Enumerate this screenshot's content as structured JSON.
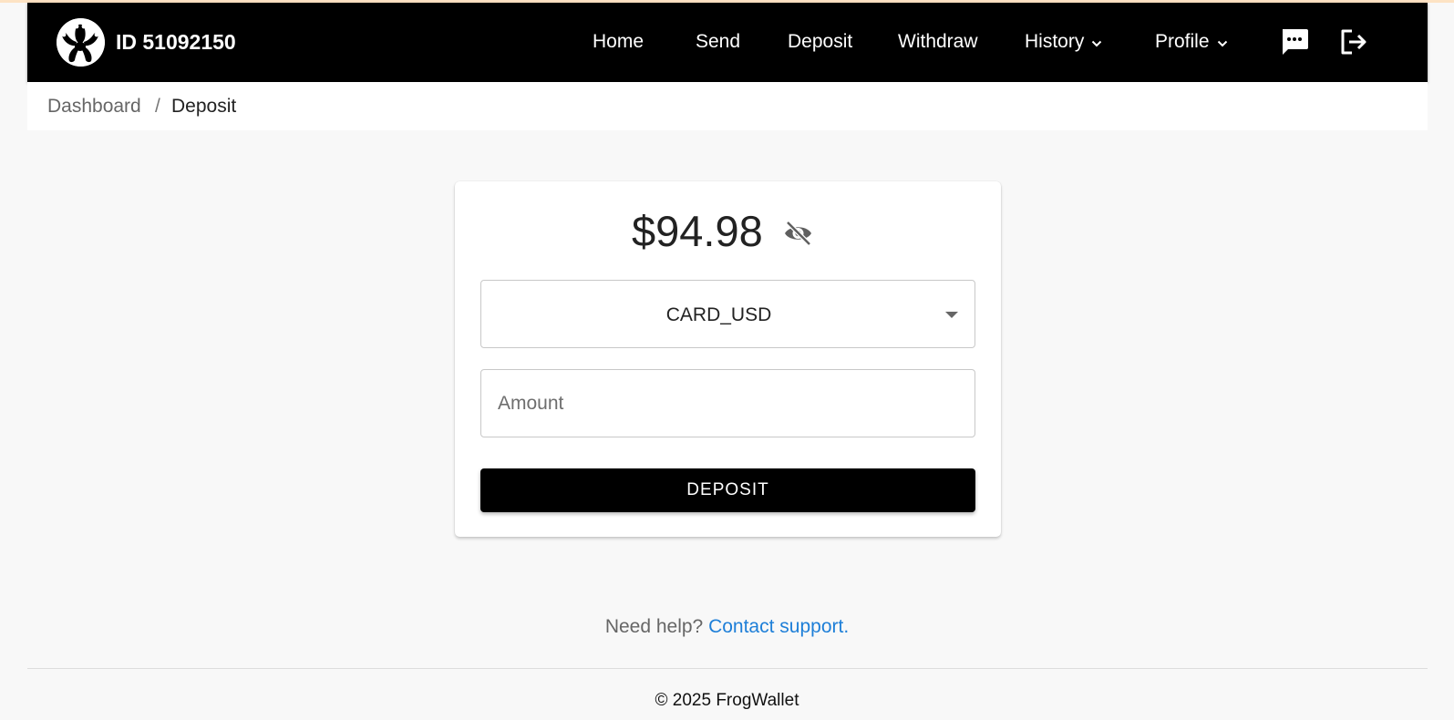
{
  "header": {
    "account_id": "ID 51092150",
    "nav": {
      "home": "Home",
      "send": "Send",
      "deposit": "Deposit",
      "withdraw": "Withdraw",
      "history": "History",
      "profile": "Profile"
    },
    "icons": [
      "frog-logo-icon",
      "chevron-down-icon",
      "chat-icon",
      "logout-icon"
    ]
  },
  "breadcrumb": {
    "parent": "Dashboard",
    "separator": "/",
    "current": "Deposit"
  },
  "deposit_card": {
    "balance": "$94.98",
    "balance_visibility_icon": "eye-off-icon",
    "method_selected": "CARD_USD",
    "amount_placeholder": "Amount",
    "amount_value": "",
    "deposit_button": "DEPOSIT"
  },
  "help": {
    "prompt": "Need help?",
    "link": "Contact support."
  },
  "footer": {
    "copyright": "© 2025 FrogWallet"
  },
  "colors": {
    "navbar_bg": "#000000",
    "page_bg": "#f8f8f8",
    "link": "#1e7fd8",
    "button_bg": "#000000"
  }
}
